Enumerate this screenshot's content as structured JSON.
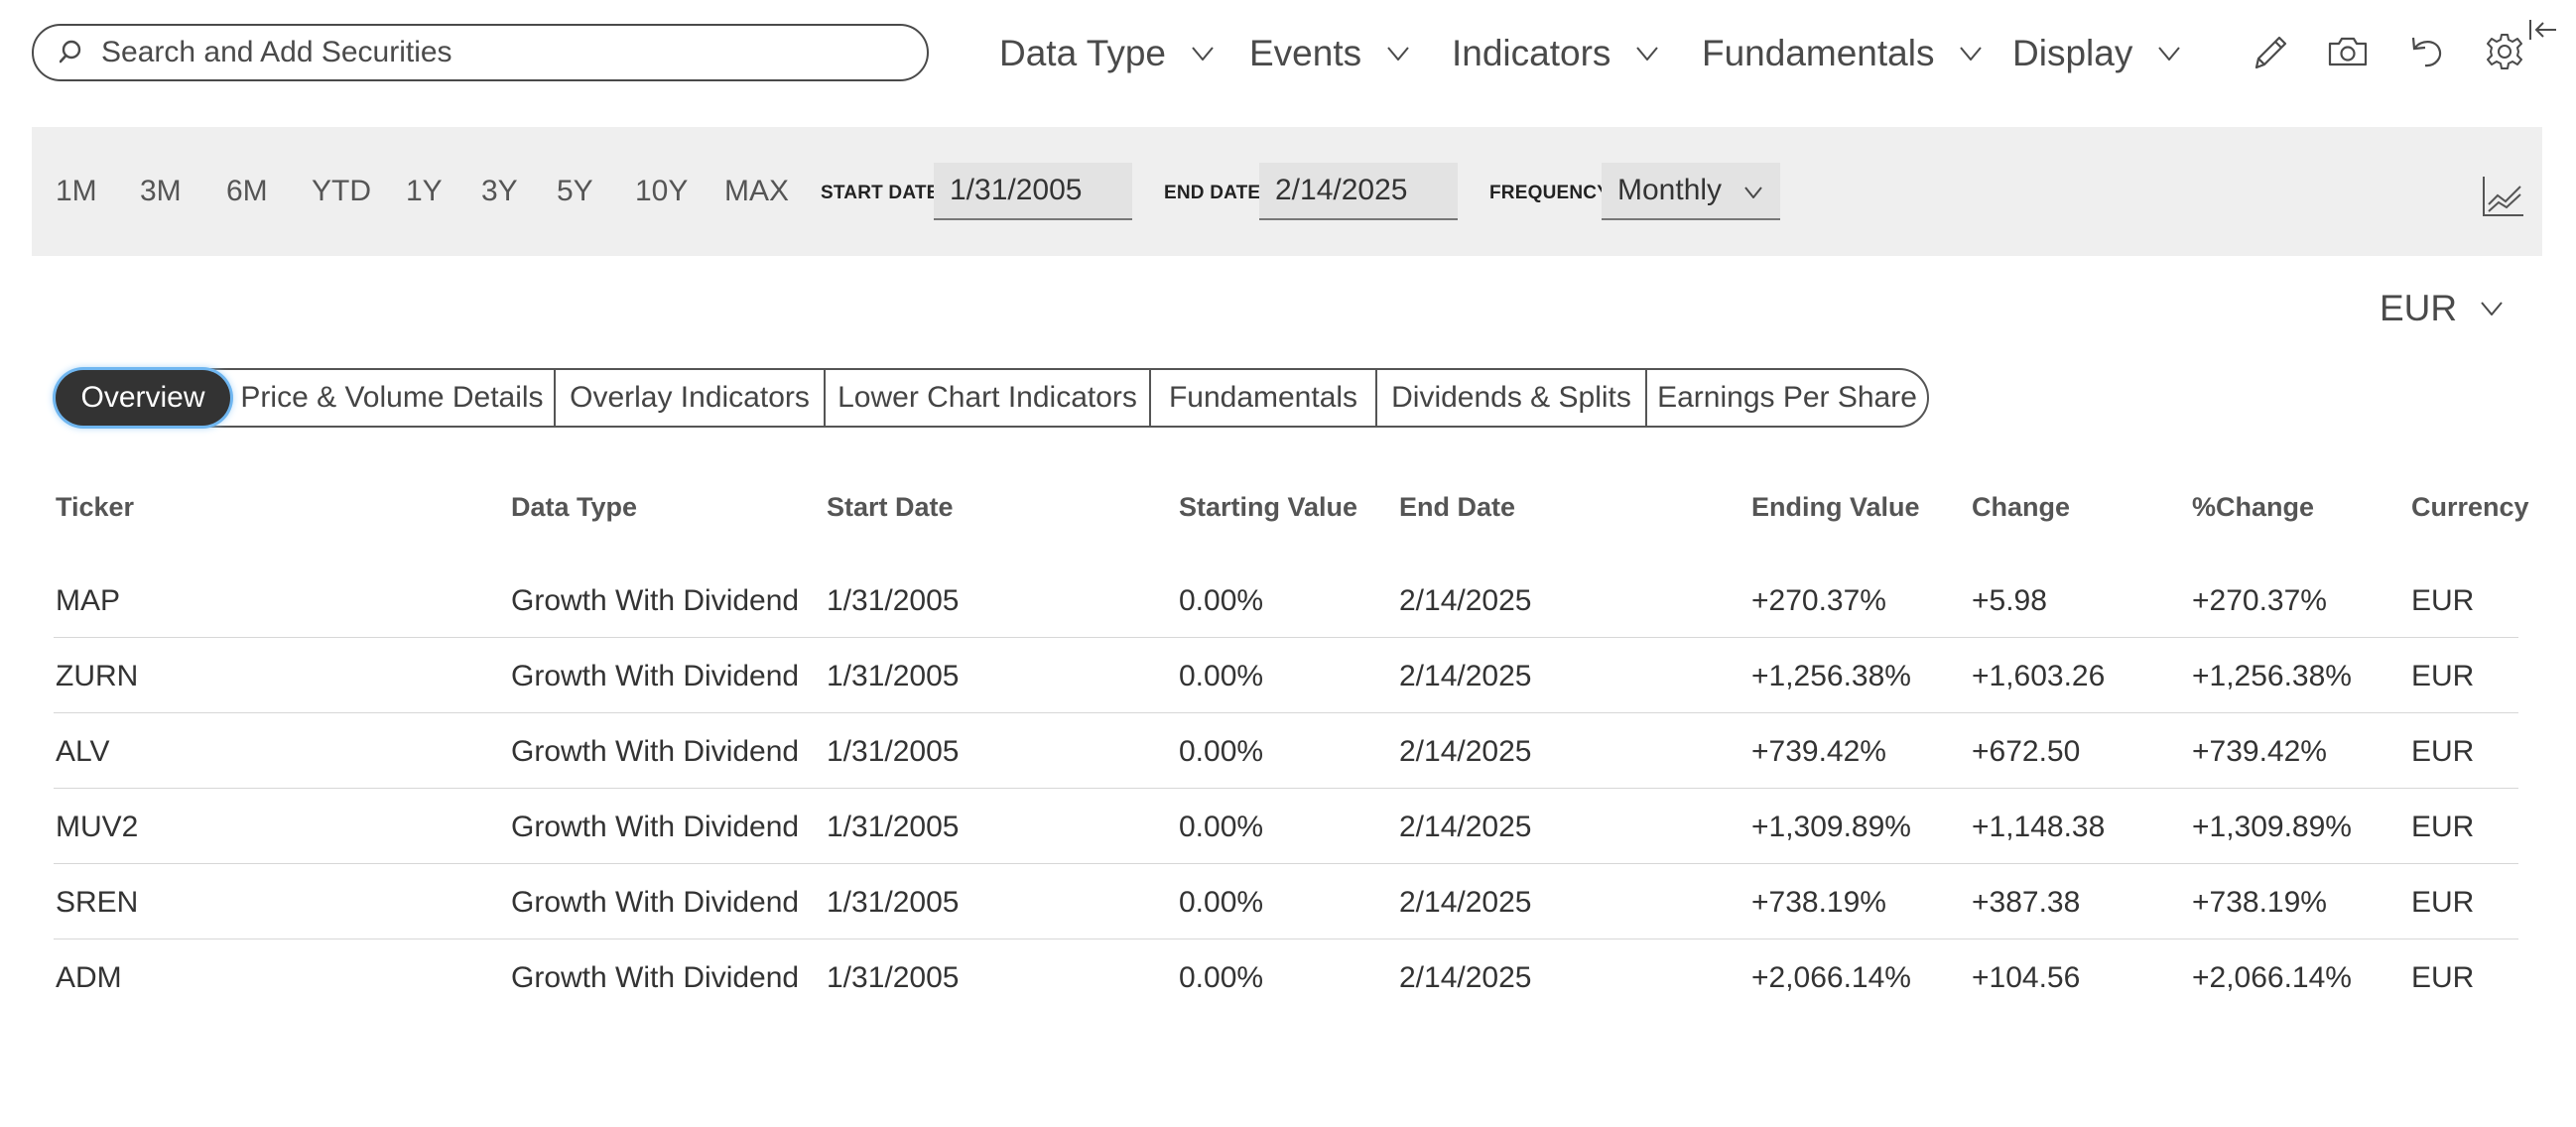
{
  "search": {
    "placeholder": "Search and Add Securities"
  },
  "menu": [
    {
      "label": "Data Type"
    },
    {
      "label": "Events"
    },
    {
      "label": "Indicators"
    },
    {
      "label": "Fundamentals"
    },
    {
      "label": "Display"
    }
  ],
  "tools": [
    "pencil-icon",
    "camera-icon",
    "undo-icon",
    "gear-icon",
    "collapse-panel-icon"
  ],
  "range": {
    "buttons": [
      "1M",
      "3M",
      "6M",
      "YTD",
      "1Y",
      "3Y",
      "5Y",
      "10Y",
      "MAX"
    ],
    "start_label": "START DATE",
    "start_value": "1/31/2005",
    "end_label": "END DATE",
    "end_value": "2/14/2025",
    "frequency_label": "FREQUENCY",
    "frequency_value": "Monthly"
  },
  "currency": "EUR",
  "tabs": [
    {
      "label": "Overview",
      "active": true
    },
    {
      "label": "Price & Volume Details"
    },
    {
      "label": "Overlay Indicators"
    },
    {
      "label": "Lower Chart Indicators"
    },
    {
      "label": "Fundamentals"
    },
    {
      "label": "Dividends & Splits"
    },
    {
      "label": "Earnings Per Share"
    }
  ],
  "table": {
    "headers": [
      "Ticker",
      "Data Type",
      "Start Date",
      "Starting Value",
      "End Date",
      "Ending Value",
      "Change",
      "%Change",
      "Currency"
    ],
    "rows": [
      [
        "MAP",
        "Growth With Dividend",
        "1/31/2005",
        "0.00%",
        "2/14/2025",
        "+270.37%",
        "+5.98",
        "+270.37%",
        "EUR"
      ],
      [
        "ZURN",
        "Growth With Dividend",
        "1/31/2005",
        "0.00%",
        "2/14/2025",
        "+1,256.38%",
        "+1,603.26",
        "+1,256.38%",
        "EUR"
      ],
      [
        "ALV",
        "Growth With Dividend",
        "1/31/2005",
        "0.00%",
        "2/14/2025",
        "+739.42%",
        "+672.50",
        "+739.42%",
        "EUR"
      ],
      [
        "MUV2",
        "Growth With Dividend",
        "1/31/2005",
        "0.00%",
        "2/14/2025",
        "+1,309.89%",
        "+1,148.38",
        "+1,309.89%",
        "EUR"
      ],
      [
        "SREN",
        "Growth With Dividend",
        "1/31/2005",
        "0.00%",
        "2/14/2025",
        "+738.19%",
        "+387.38",
        "+738.19%",
        "EUR"
      ],
      [
        "ADM",
        "Growth With Dividend",
        "1/31/2005",
        "0.00%",
        "2/14/2025",
        "+2,066.14%",
        "+104.56",
        "+2,066.14%",
        "EUR"
      ]
    ]
  }
}
